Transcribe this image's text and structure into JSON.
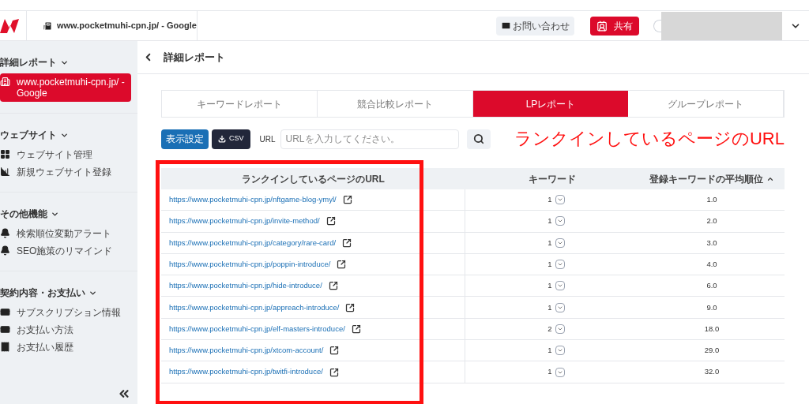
{
  "header": {
    "site_title": "www.pocketmuhi-cpn.jp/ - Google",
    "contact_button": "お問い合わせ",
    "share_button": "共有"
  },
  "sidebar": {
    "sections": [
      {
        "title": "詳細レポート",
        "items": [
          {
            "label": "www.pocketmuhi-cpn.jp/ - Google",
            "selected": true
          }
        ]
      },
      {
        "title": "ウェブサイト",
        "items": [
          {
            "label": "ウェブサイト管理",
            "selected": false
          },
          {
            "label": "新規ウェブサイト登録",
            "selected": false
          }
        ]
      },
      {
        "title": "その他機能",
        "items": [
          {
            "label": "検索順位変動アラート",
            "selected": false
          },
          {
            "label": "SEO施策のリマインド",
            "selected": false
          }
        ]
      },
      {
        "title": "契約内容・お支払い",
        "items": [
          {
            "label": "サブスクリプション情報",
            "selected": false
          },
          {
            "label": "お支払い方法",
            "selected": false
          },
          {
            "label": "お支払い履歴",
            "selected": false
          }
        ]
      }
    ]
  },
  "page_title": "詳細レポート",
  "tabs": [
    {
      "label": "キーワードレポート",
      "selected": false
    },
    {
      "label": "競合比較レポート",
      "selected": false
    },
    {
      "label": "LPレポート",
      "selected": true
    },
    {
      "label": "グループレポート",
      "selected": false
    }
  ],
  "toolbar": {
    "display_settings_button": "表示設定",
    "csv_button": "CSV",
    "url_label": "URL",
    "url_placeholder": "URLを入力してください。"
  },
  "table": {
    "columns": [
      "ランクインしているページのURL",
      "キーワード",
      "登録キーワードの平均順位"
    ],
    "rows": [
      {
        "url": "https://www.pocketmuhi-cpn.jp/nftgame-blog-ymyl/",
        "keywords": "1",
        "average_rank": "1.0"
      },
      {
        "url": "https://www.pocketmuhi-cpn.jp/invite-method/",
        "keywords": "1",
        "average_rank": "2.0"
      },
      {
        "url": "https://www.pocketmuhi-cpn.jp/category/rare-card/",
        "keywords": "1",
        "average_rank": "3.0"
      },
      {
        "url": "https://www.pocketmuhi-cpn.jp/poppin-introduce/",
        "keywords": "1",
        "average_rank": "4.0"
      },
      {
        "url": "https://www.pocketmuhi-cpn.jp/hide-introduce/",
        "keywords": "1",
        "average_rank": "6.0"
      },
      {
        "url": "https://www.pocketmuhi-cpn.jp/appreach-introduce/",
        "keywords": "1",
        "average_rank": "9.0"
      },
      {
        "url": "https://www.pocketmuhi-cpn.jp/elf-masters-introduce/",
        "keywords": "2",
        "average_rank": "18.0"
      },
      {
        "url": "https://www.pocketmuhi-cpn.jp/xtcom-account/",
        "keywords": "1",
        "average_rank": "29.0"
      },
      {
        "url": "https://www.pocketmuhi-cpn.jp/twitfi-introduce/",
        "keywords": "1",
        "average_rank": "32.0"
      }
    ]
  },
  "annotation": {
    "text": "ランクインしているページのURL"
  }
}
